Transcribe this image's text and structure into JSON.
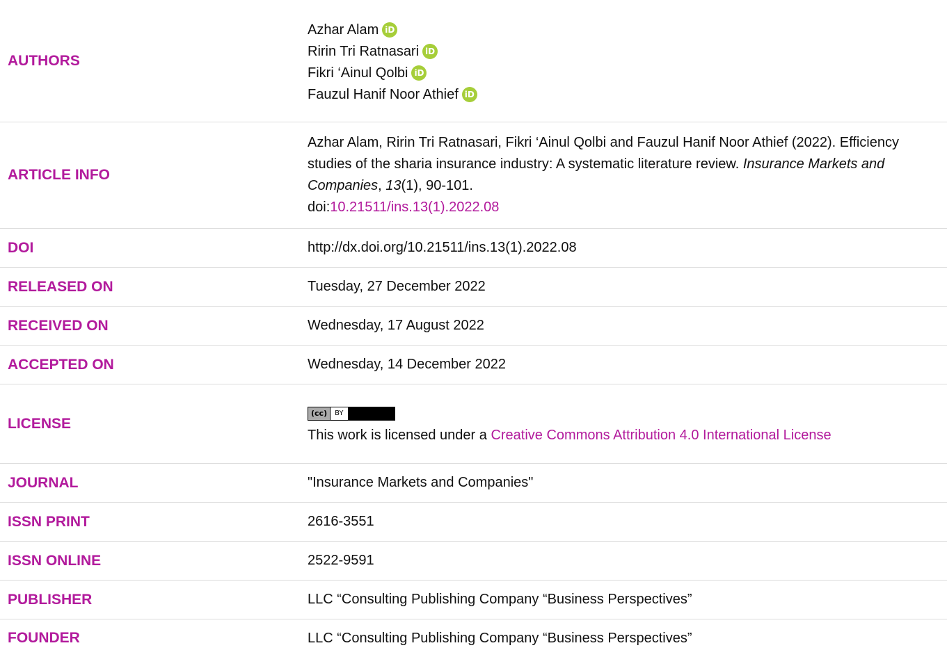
{
  "authors": {
    "label": "AUTHORS",
    "names": [
      "Azhar Alam",
      "Ririn Tri Ratnasari",
      "Fikri ‘Ainul Qolbi",
      "Fauzul Hanif Noor Athief"
    ],
    "orcid_glyph": "iD"
  },
  "article_info": {
    "label": "ARTICLE INFO",
    "citation_authors": "Azhar Alam, Ririn Tri Ratnasari, Fikri ‘Ainul Qolbi and Fauzul Hanif Noor Athief",
    "citation_year_title": "(2022). Efficiency studies of the sharia insurance industry: A systematic literature review. ",
    "journal": "Insurance Markets and Companies",
    "comma": ", ",
    "volume": "13",
    "issue_pages": "(1), 90-101.",
    "doi_prefix": "doi:",
    "doi_link": "10.21511/ins.13(1).2022.08"
  },
  "doi": {
    "label": "DOI",
    "value": "http://dx.doi.org/10.21511/ins.13(1).2022.08"
  },
  "released": {
    "label": "RELEASED ON",
    "value": "Tuesday, 27 December 2022"
  },
  "received": {
    "label": "RECEIVED ON",
    "value": "Wednesday, 17 August 2022"
  },
  "accepted": {
    "label": "ACCEPTED ON",
    "value": "Wednesday, 14 December 2022"
  },
  "license": {
    "label": "LICENSE",
    "badge_cc": "(cc)",
    "badge_by": "BY",
    "text_prefix": "This work is licensed under a ",
    "link_text": "Creative Commons Attribution 4.0 International License"
  },
  "journal": {
    "label": "JOURNAL",
    "value": "\"Insurance Markets and Companies\""
  },
  "issn_print": {
    "label": "ISSN PRINT",
    "value": "2616-3551"
  },
  "issn_online": {
    "label": "ISSN ONLINE",
    "value": "2522-9591"
  },
  "publisher": {
    "label": "PUBLISHER",
    "value": "LLC “Consulting Publishing Company “Business Perspectives”"
  },
  "founder": {
    "label": "FOUNDER",
    "value": "LLC “Consulting Publishing Company “Business Perspectives”"
  },
  "colors": {
    "accent": "#b21a9c",
    "orcid": "#a6ce39",
    "divider": "#dcdcdc"
  }
}
